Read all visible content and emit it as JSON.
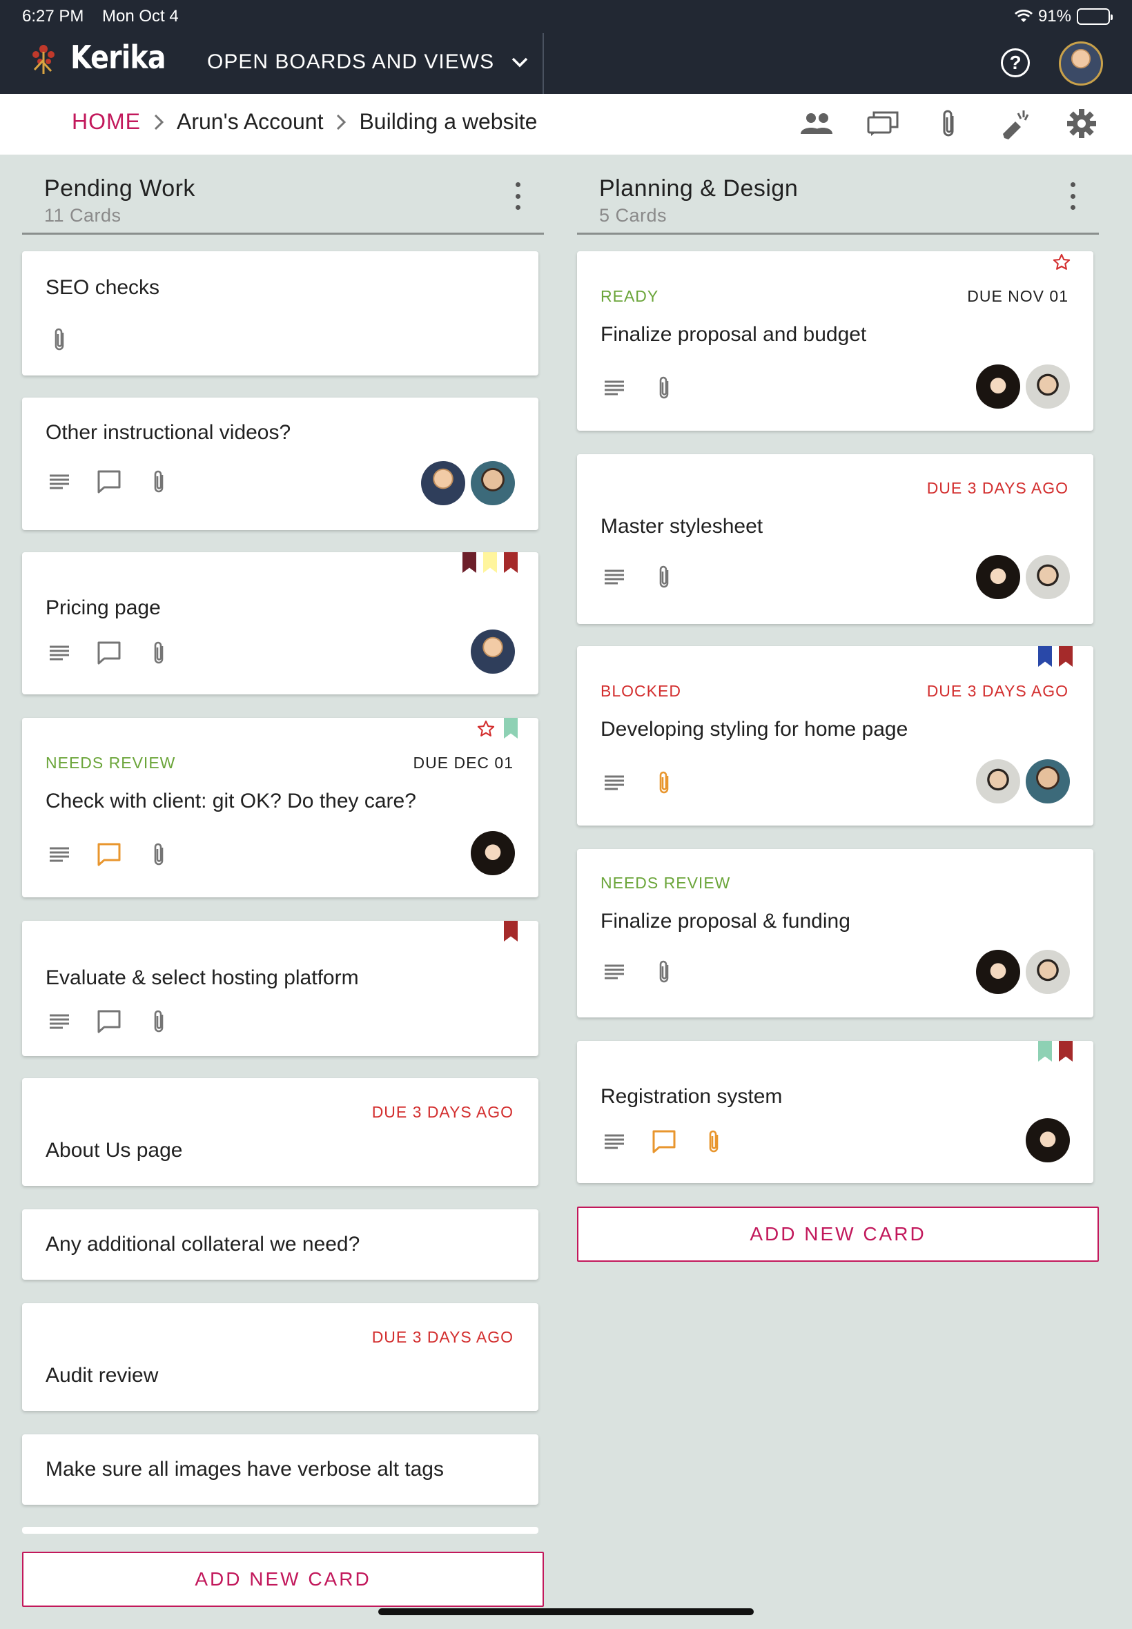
{
  "status_bar": {
    "time": "6:27 PM",
    "date": "Mon Oct 4",
    "battery": "91%",
    "battery_level": 0.91
  },
  "app": {
    "name": "Kerika",
    "boards_menu_label": "OPEN BOARDS AND VIEWS",
    "help_label": "?"
  },
  "breadcrumb": {
    "home": "HOME",
    "account": "Arun's Account",
    "board": "Building a website",
    "separator": ">"
  },
  "toolbar": {
    "icons": [
      "team-icon",
      "chat-icon",
      "attachment-icon",
      "highlight-icon",
      "settings-icon"
    ]
  },
  "columns": [
    {
      "title": "Pending Work",
      "count": "11 Cards",
      "cards": [
        {
          "title": "SEO checks",
          "icons": [
            "attachment"
          ],
          "avatars": []
        },
        {
          "title": "Other instructional videos?",
          "icons": [
            "description",
            "chat",
            "attachment"
          ],
          "avatars": [
            "arun",
            "man"
          ]
        },
        {
          "title": "Pricing page",
          "icons": [
            "description",
            "chat",
            "attachment"
          ],
          "avatars": [
            "arun"
          ],
          "flags": [
            "#6d1f2a",
            "#fff59d",
            "#a52a2a"
          ]
        },
        {
          "status": "NEEDS REVIEW",
          "due": "DUE DEC 01",
          "title": "Check with client: git OK? Do they care?",
          "icons": [
            "description",
            "chat-highlight",
            "attachment"
          ],
          "avatars": [
            "woman"
          ],
          "flags": [
            "#8ed1b4"
          ],
          "starred": true
        },
        {
          "title": "Evaluate & select hosting platform",
          "icons": [
            "description",
            "chat",
            "attachment"
          ],
          "avatars": [],
          "flags": [
            "#a52a2a"
          ]
        },
        {
          "due": "DUE 3 DAYS AGO",
          "title": "About Us page"
        },
        {
          "title": "Any additional collateral we need?"
        },
        {
          "due": "DUE 3 DAYS AGO",
          "title": "Audit review"
        },
        {
          "title": "Make sure all images have verbose alt tags"
        }
      ],
      "add_label": "ADD NEW CARD"
    },
    {
      "title": "Planning & Design",
      "count": "5 Cards",
      "cards": [
        {
          "status": "READY",
          "due": "DUE NOV 01",
          "title": "Finalize proposal and budget",
          "icons": [
            "description",
            "attachment"
          ],
          "avatars": [
            "woman",
            "glasses"
          ],
          "starred": true
        },
        {
          "due": "DUE 3 DAYS AGO",
          "title": "Master stylesheet",
          "icons": [
            "description",
            "attachment"
          ],
          "avatars": [
            "woman",
            "glasses"
          ]
        },
        {
          "status": "BLOCKED",
          "due": "DUE 3 DAYS AGO",
          "title": "Developing styling for home page",
          "icons": [
            "description",
            "attachment-highlight"
          ],
          "avatars": [
            "glasses",
            "man"
          ],
          "flags": [
            "#2948a8",
            "#a52a2a"
          ]
        },
        {
          "status": "NEEDS REVIEW",
          "title": "Finalize proposal & funding",
          "icons": [
            "description",
            "attachment"
          ],
          "avatars": [
            "woman",
            "glasses"
          ]
        },
        {
          "title": "Registration system",
          "icons": [
            "description",
            "chat-highlight",
            "attachment-highlight"
          ],
          "avatars": [
            "woman"
          ],
          "flags": [
            "#8ed1b4",
            "#a52a2a"
          ]
        }
      ],
      "add_label": "ADD NEW CARD"
    }
  ],
  "colors": {
    "accent": "#c2185b",
    "topbar": "#222833",
    "board_bg": "#dae2df",
    "status_green": "#6ba53a",
    "status_red": "#d32f2f",
    "highlight_orange": "#e8962e"
  }
}
